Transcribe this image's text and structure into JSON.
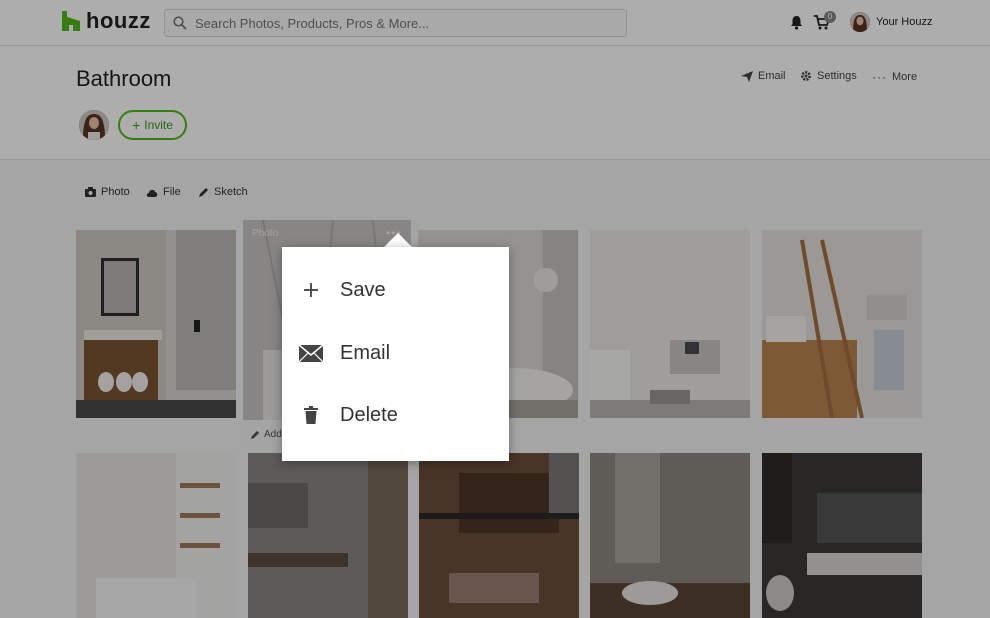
{
  "header": {
    "logo_text": "houzz",
    "search_placeholder": "Search Photos, Products, Pros & More...",
    "cart_count": "0",
    "user_label": "Your Houzz"
  },
  "project": {
    "title": "Bathroom",
    "actions": {
      "email": "Email",
      "settings": "Settings",
      "more": "More"
    },
    "invite_label": "Invite"
  },
  "toolbar": {
    "photo": "Photo",
    "file": "File",
    "sketch": "Sketch"
  },
  "hovered_tile": {
    "type_label": "Photo",
    "add_note": "Add"
  },
  "context_menu": {
    "items": [
      {
        "label": "Save",
        "icon": "plus-icon"
      },
      {
        "label": "Email",
        "icon": "envelope-icon"
      },
      {
        "label": "Delete",
        "icon": "trash-icon"
      }
    ]
  },
  "colors": {
    "brand_green": "#4dbc15",
    "overlay": "rgba(0,0,0,0.32)"
  }
}
